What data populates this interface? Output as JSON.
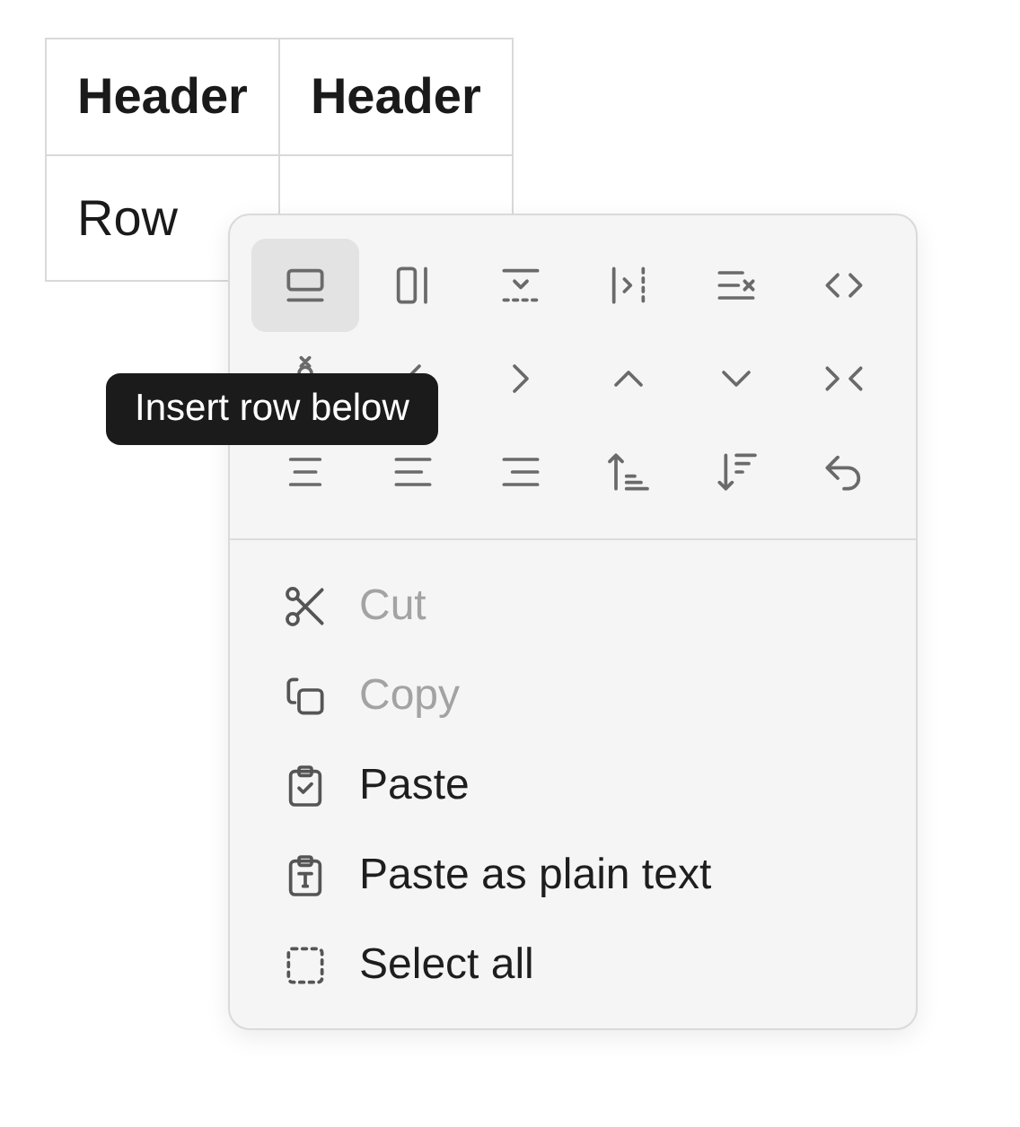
{
  "table": {
    "columns": [
      "Header",
      "Header"
    ],
    "rows": [
      [
        "Row",
        ""
      ]
    ]
  },
  "context_menu": {
    "toolbar": [
      {
        "selected": true
      },
      {
        "selected": false
      },
      {
        "selected": false
      },
      {
        "selected": false
      },
      {
        "selected": false
      },
      {
        "selected": false
      },
      {
        "selected": false
      },
      {
        "selected": false
      },
      {
        "selected": false
      },
      {
        "selected": false
      },
      {
        "selected": false
      },
      {
        "selected": false
      },
      {
        "selected": false
      },
      {
        "selected": false
      },
      {
        "selected": false
      },
      {
        "selected": false
      },
      {
        "selected": false
      },
      {
        "selected": false
      }
    ],
    "tooltip": "Insert row below",
    "items": [
      {
        "label": "Cut",
        "disabled": true
      },
      {
        "label": "Copy",
        "disabled": true
      },
      {
        "label": "Paste",
        "disabled": false
      },
      {
        "label": "Paste as plain text",
        "disabled": false
      },
      {
        "label": "Select all",
        "disabled": false
      }
    ]
  }
}
